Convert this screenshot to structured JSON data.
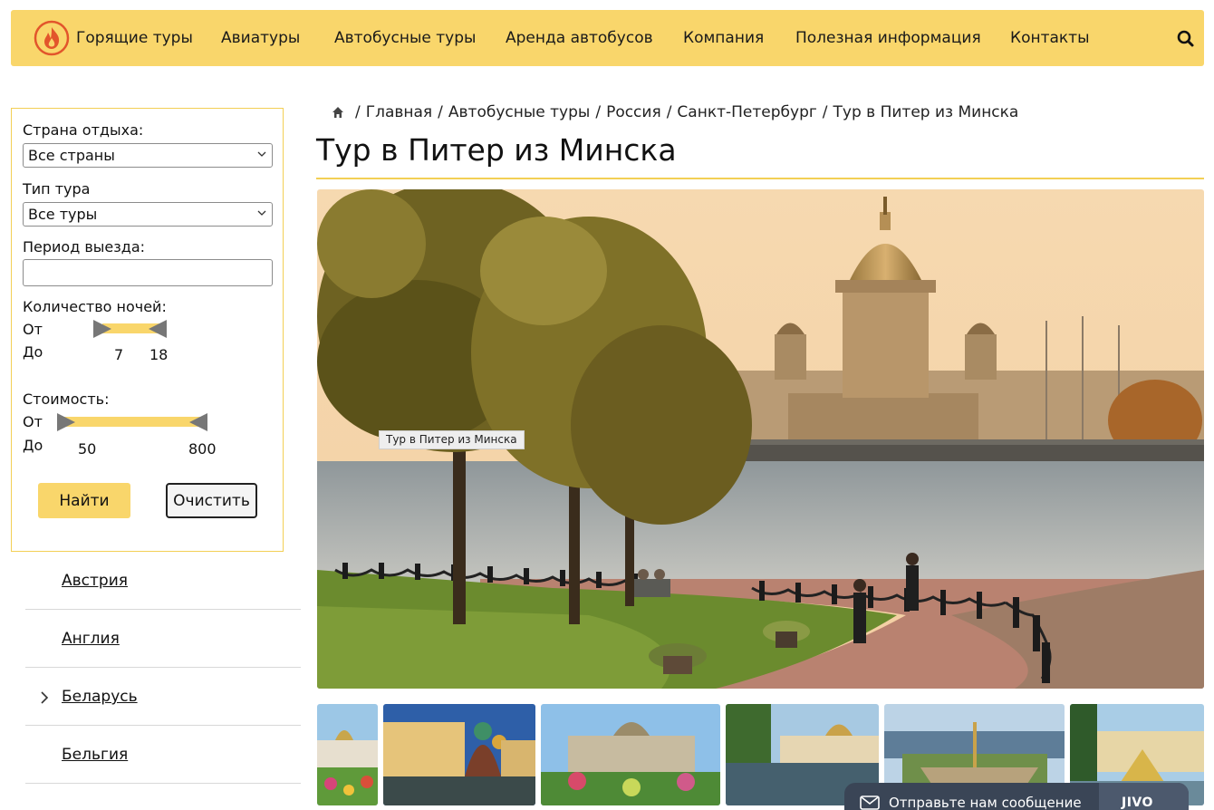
{
  "nav": {
    "items": [
      "Горящие туры",
      "Авиатуры",
      "Автобусные туры",
      "Аренда автобусов",
      "Компания",
      "Полезная информация",
      "Контакты"
    ],
    "accent": "#f9d66b"
  },
  "filter": {
    "country_label": "Страна отдыха:",
    "country_value": "Все страны",
    "type_label": "Тип тура",
    "type_value": "Все туры",
    "period_label": "Период выезда:",
    "nights_label": "Количество ночей:",
    "from_label": "От",
    "to_label": "До",
    "nights_from": "7",
    "nights_to": "18",
    "cost_label": "Стоимость:",
    "cost_from": "50",
    "cost_to": "800",
    "find_label": "Найти",
    "clear_label": "Очистить"
  },
  "countries": [
    {
      "name": "Австрия",
      "expandable": false
    },
    {
      "name": "Англия",
      "expandable": false
    },
    {
      "name": "Беларусь",
      "expandable": true
    },
    {
      "name": "Бельгия",
      "expandable": false
    }
  ],
  "breadcrumb": [
    "Главная",
    "Автобусные туры",
    "Россия",
    "Санкт-Петербург",
    "Тур в Питер из Минска"
  ],
  "page": {
    "title": "Тур в Питер из Минска",
    "photo_caption": "Тур в Питер из Минска"
  },
  "chat": {
    "text": "Отправьте нам сообщение",
    "brand": "JIVO"
  }
}
